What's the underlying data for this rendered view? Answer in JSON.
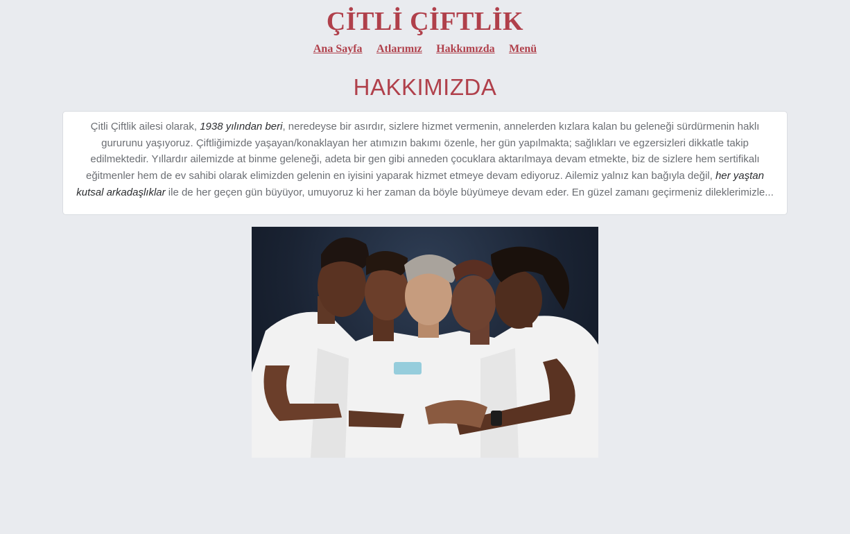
{
  "header": {
    "title": "ÇİTLİ ÇİFTLİK",
    "nav": [
      {
        "label": "Ana Sayfa"
      },
      {
        "label": "Atlarımız"
      },
      {
        "label": "Hakkımızda"
      },
      {
        "label": "Menü"
      }
    ]
  },
  "about": {
    "heading": "HAKKIMIZDA",
    "text": {
      "part1": "Çitli Çiftlik ailesi olarak, ",
      "emph1": "1938 yılından beri",
      "part2": ", neredeyse bir asırdır, sizlere hizmet vermenin, annelerden kızlara kalan bu geleneği sürdürmenin haklı gururunu yaşıyoruz. Çiftliğimizde yaşayan/konaklayan her atımızın bakımı özenle, her gün yapılmakta; sağlıkları ve egzersizleri dikkatle takip edilmektedir. Yıllardır ailemizde at binme geleneği, adeta bir gen gibi anneden çocuklara aktarılmaya devam etmekte, biz de sizlere hem sertifikalı eğitmenler hem de ev sahibi olarak elimizden gelenin en iyisini yaparak hizmet etmeye devam ediyoruz. Ailemiz yalnız kan bağıyla değil, ",
      "emph2": "her yaştan kutsal arkadaşlıklar",
      "part3": " ile de her geçen gün büyüyor, umuyoruz ki her zaman da böyle büyümeye devam eder. En güzel zamanı geçirmeniz dileklerimizle..."
    }
  },
  "colors": {
    "accent": "#b0404b",
    "background": "#e9ebef",
    "card": "#ffffff"
  }
}
